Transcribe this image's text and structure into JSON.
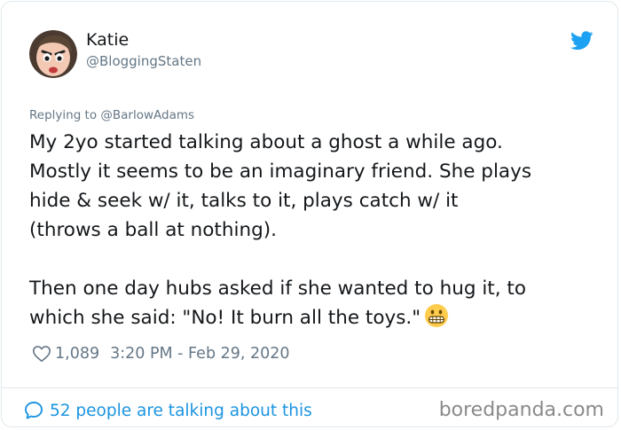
{
  "author": {
    "display_name": "Katie",
    "handle": "@BloggingStaten",
    "avatar_icon": "cartoon-face-avatar"
  },
  "tweet": {
    "replying_to": "Replying to @BarlowAdams",
    "paragraph1_lines": [
      "My 2yo started talking about a ghost a while ago.",
      "Mostly it seems to be an imaginary friend. She plays",
      "hide & seek w/ it, talks to it, plays catch w/ it",
      "(throws a ball at nothing)."
    ],
    "paragraph2_lines": [
      "Then one day hubs asked if she wanted to hug it, to",
      "which she said: \"No! It burn all the toys.\""
    ],
    "emoji": "grimacing-face-emoji"
  },
  "meta": {
    "like_count": "1,089",
    "timestamp": "3:20 PM - Feb 29, 2020"
  },
  "footer": {
    "conversation_label": "52 people are talking about this",
    "watermark": "boredpanda.com"
  },
  "colors": {
    "accent": "#1da1f2",
    "link": "#1b95e0",
    "text": "#14171a",
    "secondary": "#657786",
    "border": "#e1e8ed"
  }
}
